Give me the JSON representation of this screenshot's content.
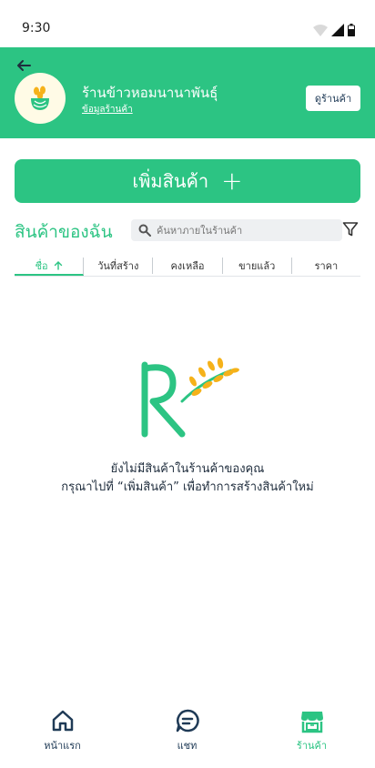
{
  "status": {
    "time": "9:30"
  },
  "header": {
    "shop_name": "ร้านข้าวหอมนานาพันธุ์",
    "shop_info_link": "ข้อมูลร้านค้า",
    "view_shop_button": "ดูร้านค้า"
  },
  "add_product_button": "เพิ่มสินค้า",
  "products": {
    "title": "สินค้าของฉัน",
    "search_placeholder": "ค้นหาภายในร้านค้า",
    "sort_tabs": [
      {
        "label": "ชื่อ",
        "active": true,
        "direction": "ascending"
      },
      {
        "label": "วันที่สร้าง",
        "active": false
      },
      {
        "label": "คงเหลือ",
        "active": false
      },
      {
        "label": "ขายแล้ว",
        "active": false
      },
      {
        "label": "ราคา",
        "active": false
      }
    ]
  },
  "empty_state": {
    "line1": "ยังไม่มีสินค้าในร้านค้าของคุณ",
    "line2": "กรุณาไปที่ “เพิ่มสินค้า” เพื่อทำการสร้างสินค้าใหม่"
  },
  "bottom_nav": [
    {
      "label": "หน้าแรก",
      "icon": "home-icon",
      "active": false
    },
    {
      "label": "แชท",
      "icon": "chat-icon",
      "active": false
    },
    {
      "label": "ร้านค้า",
      "icon": "store-icon",
      "active": true
    }
  ],
  "colors": {
    "accent": "#2cc483",
    "text_dark": "#1f3a56",
    "rice_gold": "#f5b21a"
  }
}
